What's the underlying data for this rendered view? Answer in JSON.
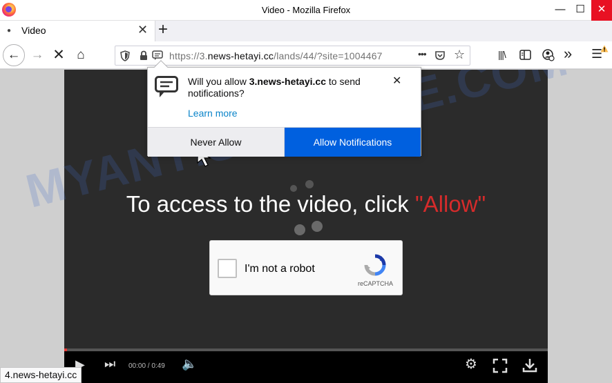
{
  "window": {
    "title": "Video - Mozilla Firefox",
    "minimize_glyph": "—",
    "maximize_glyph": "☐",
    "close_glyph": "✕"
  },
  "tabs": [
    {
      "title": "Video",
      "close_glyph": "✕"
    }
  ],
  "new_tab_glyph": "+",
  "nav": {
    "back_glyph": "←",
    "forward_glyph": "→",
    "stop_glyph": "✕",
    "home_glyph": "⌂"
  },
  "urlbar": {
    "url_prefix": "https://3.",
    "url_domain": "news-hetayi.cc",
    "url_suffix": "/lands/44/?site=1004467",
    "page_actions_glyph": "•••",
    "star_glyph": "☆"
  },
  "toolbar": {
    "library_glyph": "|||\\",
    "overflow_glyph": "»",
    "menu_glyph": "☰"
  },
  "notification": {
    "message_before": "Will you allow ",
    "site": "3.news-hetayi.cc",
    "message_after": " to send notifications?",
    "learn_more": "Learn more",
    "never_allow": "Never Allow",
    "allow": "Allow Notifications",
    "close_glyph": "✕"
  },
  "page": {
    "watermark": "MYANTISPYWARE.COM",
    "cta_text": "To access to the video, click ",
    "cta_highlight": "\"Allow\"",
    "highlight_color": "#d52b2b"
  },
  "captcha": {
    "label": "I'm not a robot",
    "brand": "reCAPTCHA",
    "checked": false
  },
  "player": {
    "time": "00:00 / 0:49",
    "progress": 0.005
  },
  "status_bar": {
    "text": "4.news-hetayi.cc"
  },
  "colors": {
    "allow_button": "#0060df",
    "link": "#0a84c9",
    "close_button": "#e81123"
  }
}
